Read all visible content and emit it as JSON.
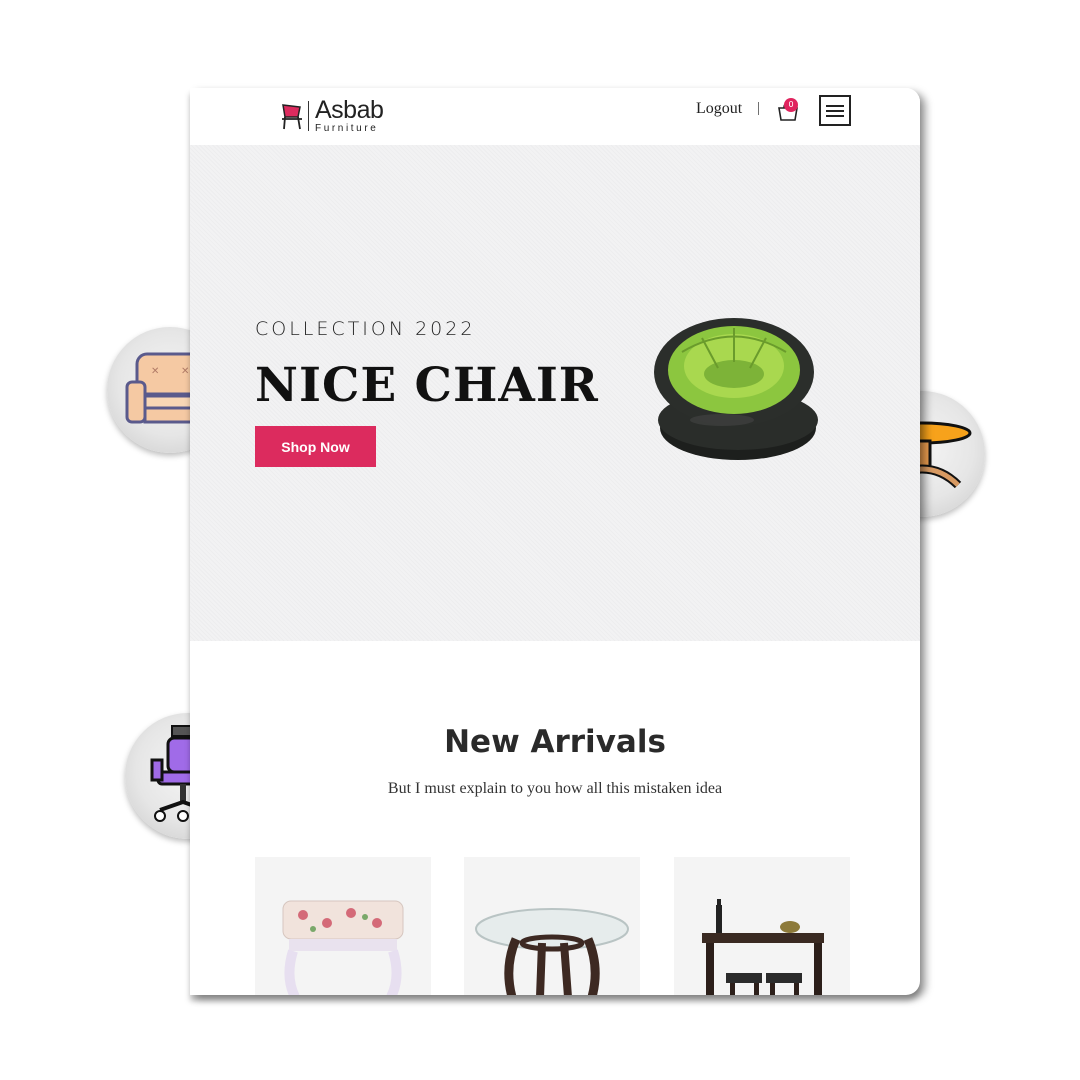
{
  "brand": {
    "name": "Asbab",
    "tagline": "Furniture"
  },
  "nav": {
    "logout_label": "Logout",
    "divider": "|",
    "cart_count": "0",
    "cart_icon": "shopping-bag-icon",
    "menu_icon": "hamburger-icon"
  },
  "hero": {
    "eyebrow": "COLLECTION 2022",
    "title": "NICE CHAIR",
    "cta_label": "Shop Now",
    "accent_color": "#dc2b5e",
    "image": "green-inflatable-chair"
  },
  "arrivals": {
    "title": "New Arrivals",
    "subtitle": "But I must explain to you how all this mistaken idea",
    "products": [
      {
        "image": "floral-stool"
      },
      {
        "image": "glass-round-table"
      },
      {
        "image": "bar-table-set"
      }
    ]
  },
  "decor_icons": [
    "sofa-icon",
    "round-table-icon",
    "office-chair-icon"
  ]
}
